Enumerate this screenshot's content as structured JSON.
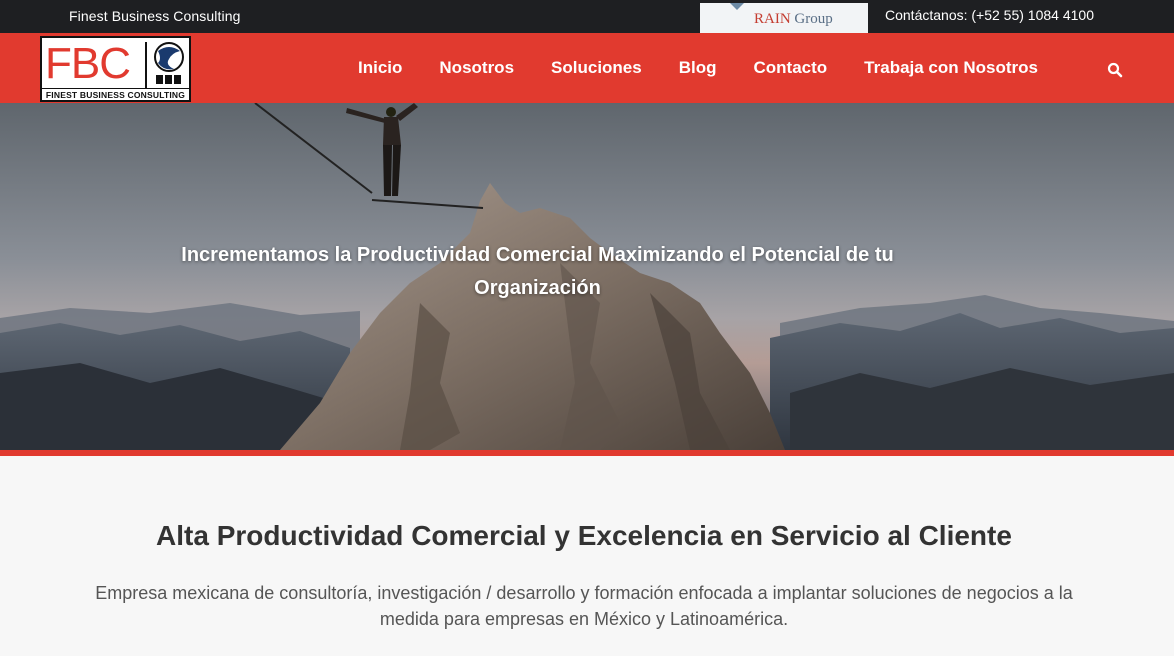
{
  "topbar": {
    "brand": "Finest Business Consulting",
    "partner_rain": "RAIN",
    "partner_group": "Group",
    "contact": "Contáctanos: (+52 55) 1084 4100"
  },
  "logo": {
    "letters": "FBC",
    "subtitle": "FINEST BUSINESS CONSULTING",
    "colors": {
      "red": "#e13a2f",
      "dark": "#111111"
    }
  },
  "nav": {
    "items": [
      {
        "label": "Inicio"
      },
      {
        "label": "Nosotros"
      },
      {
        "label": "Soluciones"
      },
      {
        "label": "Blog"
      },
      {
        "label": "Contacto"
      },
      {
        "label": "Trabaja con Nosotros"
      }
    ],
    "search_icon": "search-icon"
  },
  "hero": {
    "title": "Incrementamos la Productividad Comercial Maximizando el Potencial de tu Organización"
  },
  "intro": {
    "heading": "Alta Productividad Comercial y Excelencia en Servicio al Cliente",
    "body": "Empresa mexicana de consultoría, investigación / desarrollo y formación enfocada a implantar soluciones de negocios a la medida para empresas en México y Latinoamérica."
  },
  "colors": {
    "accent": "#e13a2f",
    "topbar": "#1e1f22",
    "section_bg": "#f7f7f7"
  }
}
